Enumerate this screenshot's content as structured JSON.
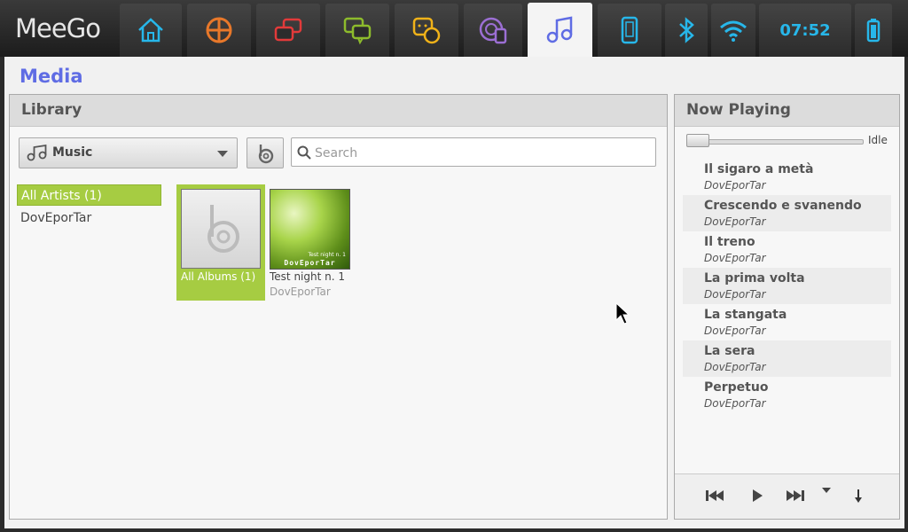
{
  "system": {
    "logo": "MeeGo",
    "clock": "07:52",
    "tabs": [
      {
        "icon": "home-icon",
        "color": "#27b7ea"
      },
      {
        "icon": "apps-grid-icon",
        "color": "#e8782a"
      },
      {
        "icon": "tasks-windows-icon",
        "color": "#e23a3a"
      },
      {
        "icon": "chat-icon",
        "color": "#8dbb2c"
      },
      {
        "icon": "people-icon",
        "color": "#f0b219"
      },
      {
        "icon": "web-photos-icon",
        "color": "#9c6fd4"
      },
      {
        "icon": "music-icon",
        "color": "#5f6ce4",
        "active": true
      },
      {
        "icon": "device-icon",
        "color": "#27b7ea"
      },
      {
        "icon": "bluetooth-icon",
        "color": "#27b7ea"
      },
      {
        "icon": "wifi-icon",
        "color": "#27b7ea"
      },
      {
        "icon": "battery-icon",
        "color": "#27b7ea"
      }
    ]
  },
  "app": {
    "title": "Media",
    "accent": "#5f6ce4",
    "highlight": "#a6cc42"
  },
  "library": {
    "header": "Library",
    "source": "Music",
    "search_placeholder": "Search",
    "search_value": "",
    "artists": [
      {
        "label": "All Artists (1)",
        "selected": true
      },
      {
        "label": "DovEporTar",
        "selected": false
      }
    ],
    "albums": [
      {
        "title": "All Albums (1)",
        "artist": "",
        "selected": true
      },
      {
        "title": "Test night n. 1",
        "artist": "DovEporTar",
        "cover_text": "Test night n. 1",
        "cover_band": "DovEporTar"
      }
    ]
  },
  "now_playing": {
    "header": "Now Playing",
    "status": "Idle",
    "progress": 0,
    "tracks": [
      {
        "title": "Il sigaro a metà",
        "artist": "DovEporTar"
      },
      {
        "title": "Crescendo e svanendo",
        "artist": "DovEporTar"
      },
      {
        "title": "Il treno",
        "artist": "DovEporTar"
      },
      {
        "title": "La prima volta",
        "artist": "DovEporTar"
      },
      {
        "title": "La stangata",
        "artist": "DovEporTar"
      },
      {
        "title": "La sera",
        "artist": "DovEporTar"
      },
      {
        "title": "Perpetuo",
        "artist": "DovEporTar"
      }
    ]
  }
}
